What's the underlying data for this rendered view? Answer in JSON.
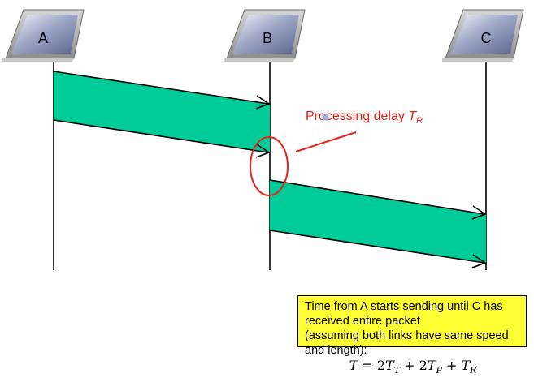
{
  "nodes": [
    {
      "id": "A",
      "label": "A"
    },
    {
      "id": "B",
      "label": "B"
    },
    {
      "id": "C",
      "label": "C"
    }
  ],
  "annotation": {
    "text": "Processing delay ",
    "symbol": "T",
    "subscript": "R",
    "color": "#e8201a"
  },
  "transmissions": [
    {
      "from": "A",
      "to": "B"
    },
    {
      "from": "B",
      "to": "C"
    }
  ],
  "colors": {
    "packet_fill": "#00cc99",
    "highlight": "#e8201a",
    "box_fill": "#ffff33"
  },
  "info_box": {
    "line1": "Time from A starts sending until C has received entire packet",
    "line2": "(assuming both links have same speed and length):",
    "formula": {
      "lhs": "T",
      "equals": " = ",
      "coef1": "2",
      "term1": "T",
      "sub1": "T",
      "plus1": " + ",
      "coef2": "2",
      "term2": "T",
      "sub2": "P",
      "plus2": " + ",
      "term3": "T",
      "sub3": "R"
    }
  }
}
